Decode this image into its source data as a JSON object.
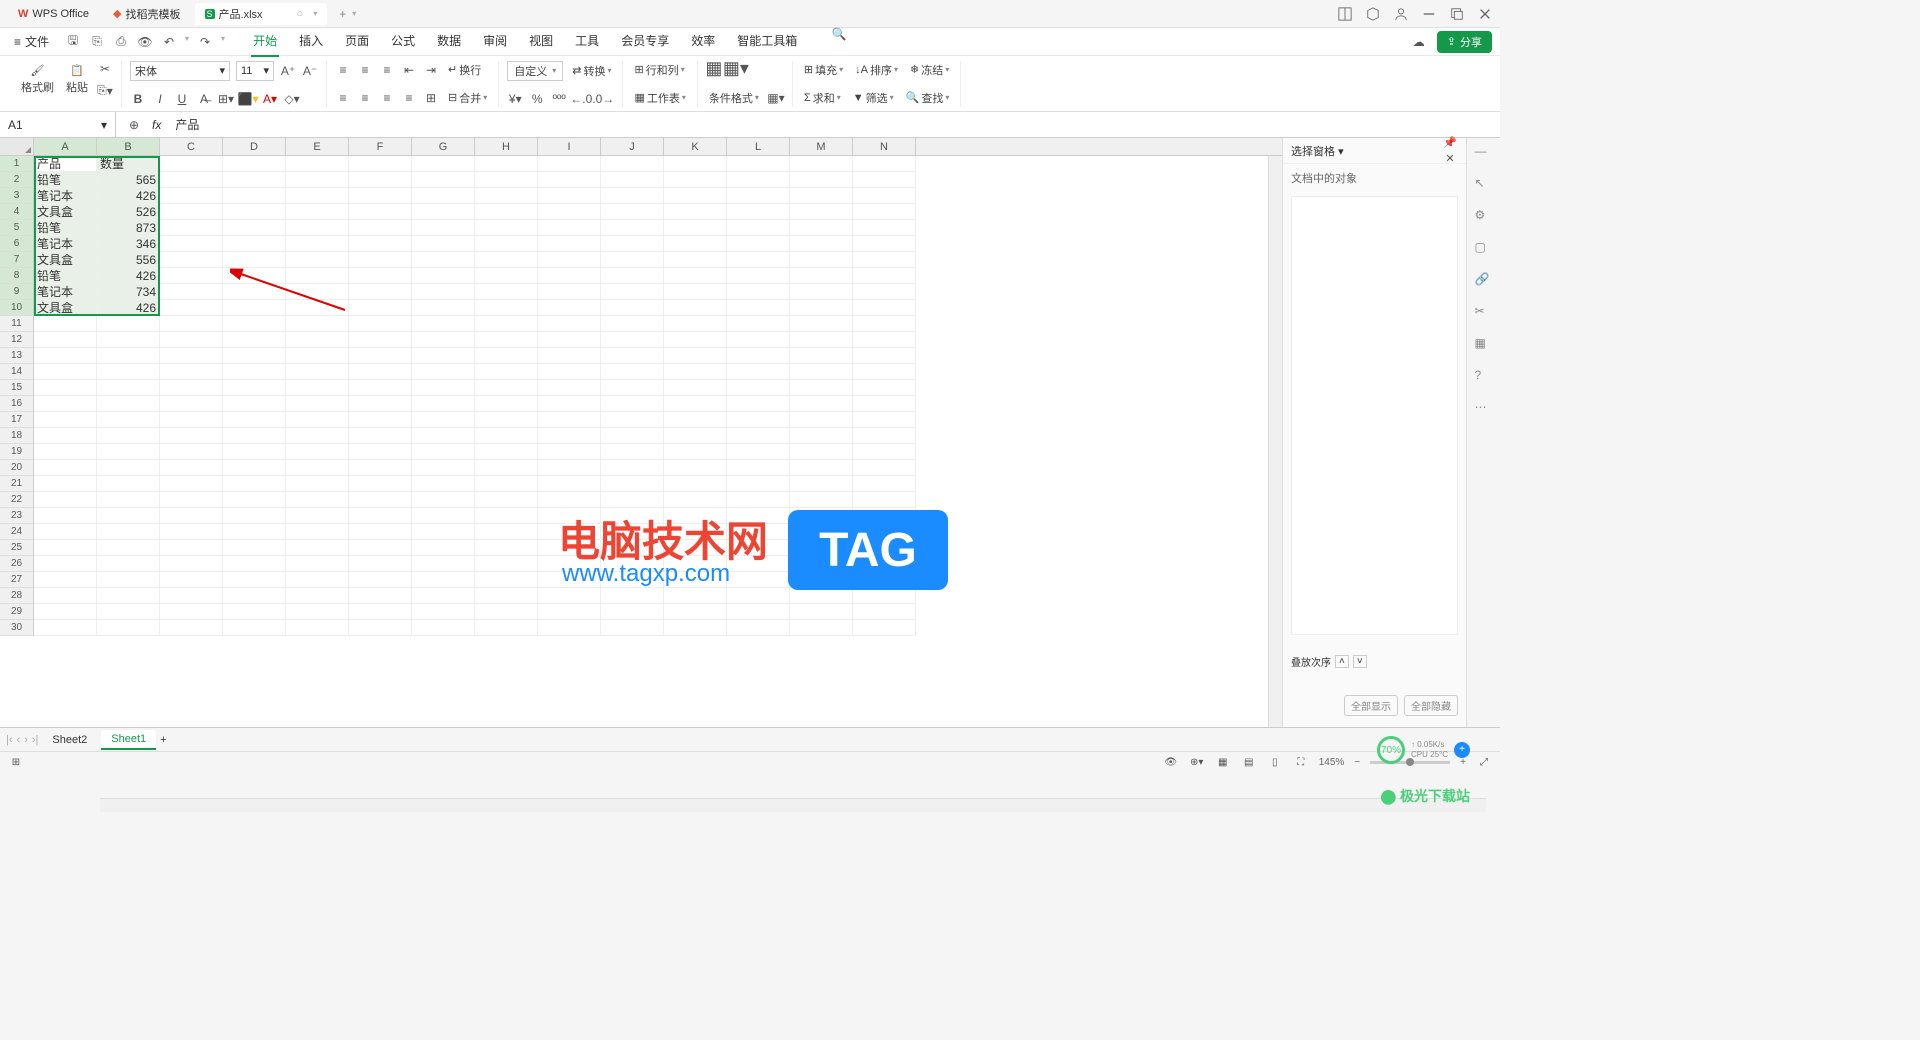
{
  "titlebar": {
    "tabs": [
      {
        "label": "WPS Office",
        "icon": "wps"
      },
      {
        "label": "找稻壳模板",
        "icon": "doc"
      },
      {
        "label": "产品.xlsx",
        "icon": "sheet",
        "active": true
      }
    ]
  },
  "menubar": {
    "file": "文件",
    "tabs": [
      "开始",
      "插入",
      "页面",
      "公式",
      "数据",
      "审阅",
      "视图",
      "工具",
      "会员专享",
      "效率",
      "智能工具箱"
    ],
    "active_tab": "开始",
    "share": "分享"
  },
  "ribbon": {
    "format_painter": "格式刷",
    "paste": "粘贴",
    "font_name": "宋体",
    "font_size": "11",
    "wrap": "换行",
    "custom": "自定义",
    "convert": "转换",
    "rowcol": "行和列",
    "worksheet": "工作表",
    "cond_format": "条件格式",
    "fill": "填充",
    "sort": "排序",
    "freeze": "冻结",
    "sum": "求和",
    "filter": "筛选",
    "find": "查找"
  },
  "formulabar": {
    "cell_ref": "A1",
    "formula": "产品"
  },
  "grid": {
    "columns": [
      "A",
      "B",
      "C",
      "D",
      "E",
      "F",
      "G",
      "H",
      "I",
      "J",
      "K",
      "L",
      "M",
      "N"
    ],
    "rows": [
      {
        "A": "产品",
        "B": "数量"
      },
      {
        "A": "铅笔",
        "B": "565"
      },
      {
        "A": "笔记本",
        "B": "426"
      },
      {
        "A": "文具盒",
        "B": "526"
      },
      {
        "A": "铅笔",
        "B": "873"
      },
      {
        "A": "笔记本",
        "B": "346"
      },
      {
        "A": "文具盒",
        "B": "556"
      },
      {
        "A": "铅笔",
        "B": "426"
      },
      {
        "A": "笔记本",
        "B": "734"
      },
      {
        "A": "文具盒",
        "B": "426"
      }
    ],
    "total_rows": 30
  },
  "sidepanel": {
    "title": "选择窗格",
    "subtitle": "文档中的对象",
    "stack_order": "叠放次序",
    "show_all": "全部显示",
    "hide_all": "全部隐藏"
  },
  "sheettabs": {
    "tabs": [
      "Sheet2",
      "Sheet1"
    ],
    "active": "Sheet1"
  },
  "statusbar": {
    "zoom": "145%"
  },
  "chart_data": {
    "type": "table",
    "title": "产品/数量",
    "headers": [
      "产品",
      "数量"
    ],
    "rows": [
      [
        "铅笔",
        565
      ],
      [
        "笔记本",
        426
      ],
      [
        "文具盒",
        526
      ],
      [
        "铅笔",
        873
      ],
      [
        "笔记本",
        346
      ],
      [
        "文具盒",
        556
      ],
      [
        "铅笔",
        426
      ],
      [
        "笔记本",
        734
      ],
      [
        "文具盒",
        426
      ]
    ]
  },
  "watermarks": {
    "w1": "电脑技术网",
    "w1b": "www.tagxp.com",
    "w2": "TAG",
    "w3": "极光下载站"
  },
  "perf": {
    "pct": "70%",
    "net": "0.05K/s",
    "cpu": "CPU 25°C"
  }
}
